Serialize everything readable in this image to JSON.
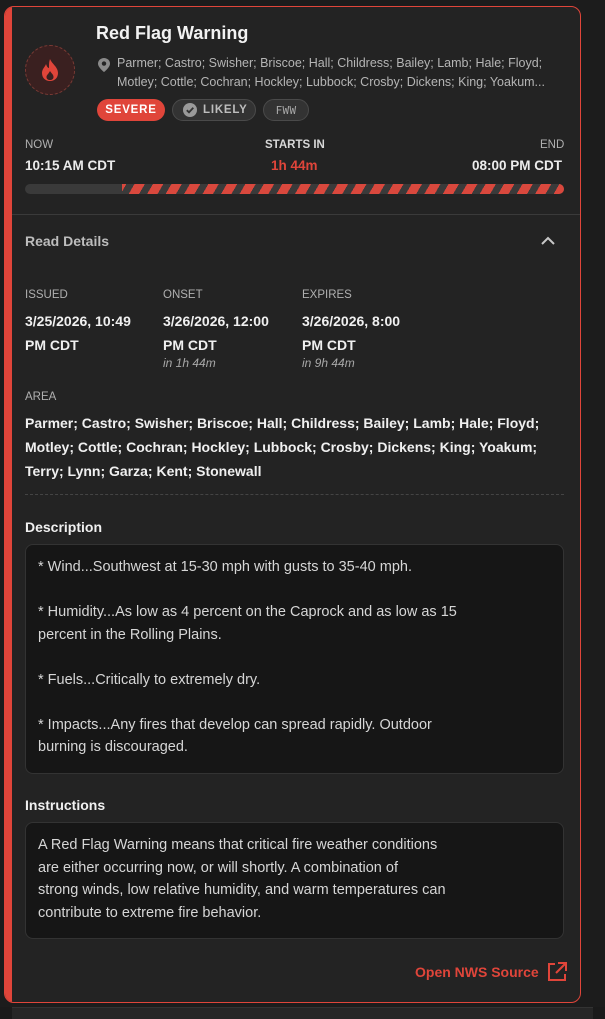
{
  "alert": {
    "title": "Red Flag Warning",
    "areas_line1": "Parmer; Castro; Swisher; Briscoe; Hall; Childress; Bailey; Lamb; Hale; Floyd;",
    "areas_line2": "Motley; Cottle; Cochran; Hockley; Lubbock; Crosby; Dickens; King; Yoakum...",
    "badges": {
      "severity": "SEVERE",
      "certainty": "LIKELY",
      "code": "FWW"
    },
    "icon": "fire-icon",
    "accent_color": "#e0453a"
  },
  "timeline": {
    "now_label": "NOW",
    "now_value": "10:15 AM CDT",
    "starts_label": "STARTS IN",
    "starts_value": "1h 44m",
    "end_label": "END",
    "end_value": "08:00 PM CDT",
    "elapsed_fraction": 0.18
  },
  "details": {
    "toggle_label": "Read Details",
    "issued": {
      "label": "ISSUED",
      "line1": "3/25/2026, 10:49",
      "line2": "PM CDT"
    },
    "onset": {
      "label": "ONSET",
      "line1": "3/26/2026, 12:00",
      "line2": "PM CDT",
      "relative": "in 1h 44m"
    },
    "expires": {
      "label": "EXPIRES",
      "line1": "3/26/2026, 8:00",
      "line2": "PM CDT",
      "relative": "in 9h 44m"
    },
    "area": {
      "label": "AREA",
      "line1": "Parmer; Castro; Swisher; Briscoe; Hall; Childress; Bailey; Lamb; Hale; Floyd;",
      "line2": "Motley; Cottle; Cochran; Hockley; Lubbock; Crosby; Dickens; King; Yoakum;",
      "line3": "Terry; Lynn; Garza; Kent; Stonewall"
    }
  },
  "description": {
    "title": "Description",
    "p1": "* Wind...Southwest at 15-30 mph with gusts to 35-40 mph.",
    "p2a": "* Humidity...As low as 4 percent on the Caprock and as low as 15",
    "p2b": "percent in the Rolling Plains.",
    "p3": "* Fuels...Critically to extremely dry.",
    "p4a": "* Impacts...Any fires that develop can spread rapidly. Outdoor",
    "p4b": "burning is discouraged."
  },
  "instructions": {
    "title": "Instructions",
    "l1": "A Red Flag Warning means that critical fire weather conditions",
    "l2": "are either occurring now, or will shortly. A combination of",
    "l3": "strong winds, low relative humidity, and warm temperatures can",
    "l4": "contribute to extreme fire behavior."
  },
  "source_link": {
    "label": "Open NWS Source",
    "icon": "external-link-icon"
  }
}
